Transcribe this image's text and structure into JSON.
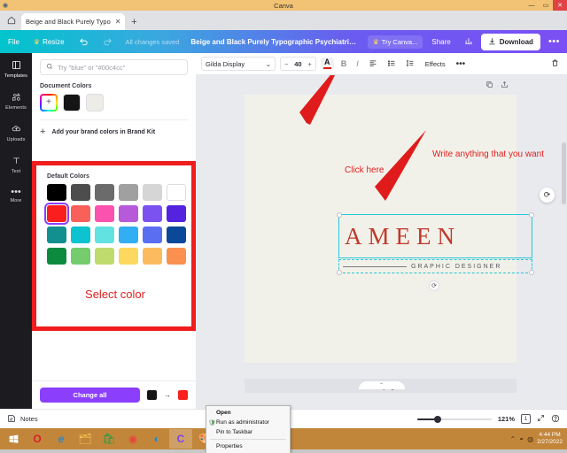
{
  "window": {
    "title": "Canva",
    "app_icon": "canva-window-icon",
    "minimize": "—",
    "maximize": "▭",
    "close": "✕"
  },
  "browser": {
    "home_icon": "home-icon",
    "tab_label": "Beige and Black Purely Typo",
    "tab_close": "✕",
    "new_tab": "+"
  },
  "topbar": {
    "file": "File",
    "resize": "Resize",
    "resize_icon": "crown-icon",
    "undo_icon": "undo-icon",
    "redo_icon": "redo-icon",
    "saved_status": "All changes saved",
    "doc_name": "Beige and Black Purely Typographic Psychiatric Do...",
    "try_canva": "Try Canva...",
    "try_canva_icon": "crown-icon",
    "share": "Share",
    "analytics_icon": "bar-chart-icon",
    "download": "Download",
    "download_icon": "download-icon",
    "more": "•••"
  },
  "rail": {
    "items": [
      {
        "label": "Templates",
        "icon": "templates-icon"
      },
      {
        "label": "Elements",
        "icon": "elements-icon"
      },
      {
        "label": "Uploads",
        "icon": "upload-cloud-icon"
      },
      {
        "label": "Text",
        "icon": "text-icon"
      },
      {
        "label": "More",
        "icon": "more-dots-icon"
      }
    ]
  },
  "panel": {
    "search_placeholder": "Try \"blue\" or \"#00c4cc\"",
    "search_icon": "search-icon",
    "document_colors_title": "Document Colors",
    "document_colors": [
      "rainbow-picker",
      "#151515",
      "#edece6"
    ],
    "add_picker_glyph": "+",
    "brandkit_label": "Add your brand colors in Brand Kit",
    "brandkit_plus": "+",
    "default_colors_title": "Default Colors",
    "default_colors": [
      "#000000",
      "#4d4d4d",
      "#6b6b6b",
      "#a0a0a0",
      "#d6d6d6",
      "#ffffff",
      "#fa1e1e",
      "#f9605a",
      "#fa52ae",
      "#b75ada",
      "#7b52f0",
      "#5522e0",
      "#11908f",
      "#0cc3cf",
      "#63e2e2",
      "#32aef4",
      "#5a6ef2",
      "#0b4899",
      "#0c8b3e",
      "#74cc6c",
      "#bfdb6e",
      "#fcd95e",
      "#fcbb5f",
      "#fa9150"
    ],
    "selected_color_index": 6,
    "annotation_select": "Select color",
    "change_all": "Change all",
    "change_from": "#151515",
    "change_to": "#fa1e1e",
    "change_arrow": "→"
  },
  "texttoolbar": {
    "font_family": "Gilda Display",
    "font_chevron": "⌄",
    "minus": "−",
    "font_size": "40",
    "plus": "+",
    "color_letter": "A",
    "color_value": "#e01b1b",
    "bold": "B",
    "italic": "I",
    "align_icon": "align-left-icon",
    "list_icon": "bullet-list-icon",
    "spacing_icon": "line-spacing-icon",
    "effects": "Effects",
    "more": "•••",
    "delete_icon": "trash-icon"
  },
  "canvas": {
    "duplicate_icon": "duplicate-icon",
    "share_page_icon": "share-page-icon",
    "refresh_icon": "refresh-icon",
    "rotate_icon": "rotate-icon",
    "heading_text": "AMEEN",
    "sub_text": "GRAPHIC DESIGNER",
    "annotation_click": "Click here",
    "annotation_write": "Write anything that you want",
    "add_page": "+ Add page",
    "annotation_color": "#e02020"
  },
  "contextmenu": {
    "items": [
      {
        "label": "Open",
        "bold": true,
        "icon": ""
      },
      {
        "label": "Run as administrator",
        "bold": false,
        "icon": "shield-icon"
      },
      {
        "label": "Pin to Taskbar",
        "bold": false,
        "icon": ""
      },
      {
        "label": "Properties",
        "bold": false,
        "icon": ""
      }
    ]
  },
  "statusbar": {
    "notes": "Notes",
    "notes_icon": "notes-icon",
    "zoom": "121%",
    "page_number": "1",
    "fullscreen_icon": "expand-icon",
    "help_icon": "help-icon",
    "scroll_chevron": "⌃"
  },
  "taskbar": {
    "start_icon": "windows-start-icon",
    "apps": [
      {
        "name": "opera-icon",
        "glyph": "O",
        "color": "#d9202a",
        "active": false
      },
      {
        "name": "internet-explorer-icon",
        "glyph": "e",
        "color": "#4aa3dd",
        "active": false
      },
      {
        "name": "file-explorer-icon",
        "glyph": "🗂",
        "color": "#f6c453",
        "active": false
      },
      {
        "name": "microsoft-store-icon",
        "glyph": "🛍",
        "color": "#1a9c4a",
        "active": false
      },
      {
        "name": "chrome-icon",
        "glyph": "◉",
        "color": "#e8453c",
        "active": false
      },
      {
        "name": "edge-icon",
        "glyph": "◐",
        "color": "#1b8cd0",
        "active": false
      },
      {
        "name": "canva-icon",
        "glyph": "C",
        "color": "#7b3ff5",
        "active": true
      },
      {
        "name": "paint-icon",
        "glyph": "🎨",
        "color": "#888888",
        "active": false
      }
    ],
    "tray": [
      "show-hidden-icons",
      "antivirus-icon",
      "network-icon"
    ],
    "clock_time": "4:44 PM",
    "clock_date": "2/27/2022"
  }
}
